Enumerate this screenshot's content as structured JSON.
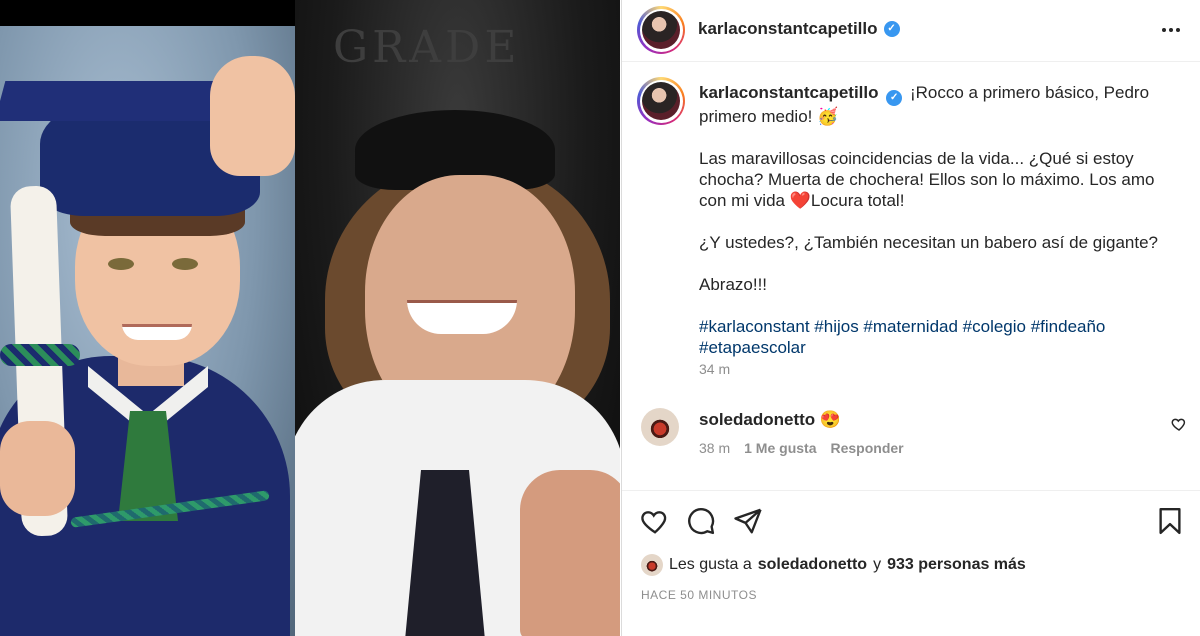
{
  "header": {
    "username": "karlaconstantcapetillo",
    "verified_mark": "✓",
    "more_icon": "more-horizontal-icon"
  },
  "photo": {
    "sign_text": "GRADE"
  },
  "caption": {
    "username": "karlaconstantcapetillo",
    "line1": "¡Rocco a primero básico, Pedro primero medio! 🥳",
    "para2": "Las maravillosas coincidencias de la vida... ¿Qué si estoy chocha? Muerta de chochera! Ellos son lo máximo. Los amo con mi vida ❤️Locura total!",
    "para3": "¿Y ustedes?, ¿También necesitan un babero así de gigante?",
    "para4": "Abrazo!!!",
    "hashtags": "#karlaconstant #hijos #maternidad #colegio #findeaño #etapaescolar",
    "time": "34 m"
  },
  "comment": {
    "username": "soledadonetto",
    "text": "😍",
    "time": "38 m",
    "likes": "1 Me gusta",
    "reply": "Responder"
  },
  "actions": {
    "like_icon": "heart-icon",
    "comment_icon": "comment-icon",
    "share_icon": "send-icon",
    "save_icon": "bookmark-icon"
  },
  "likes": {
    "prefix": "Les gusta a",
    "user": "soledadonetto",
    "connector": "y",
    "others": "933 personas más"
  },
  "posted_ago": "HACE 50 MINUTOS"
}
